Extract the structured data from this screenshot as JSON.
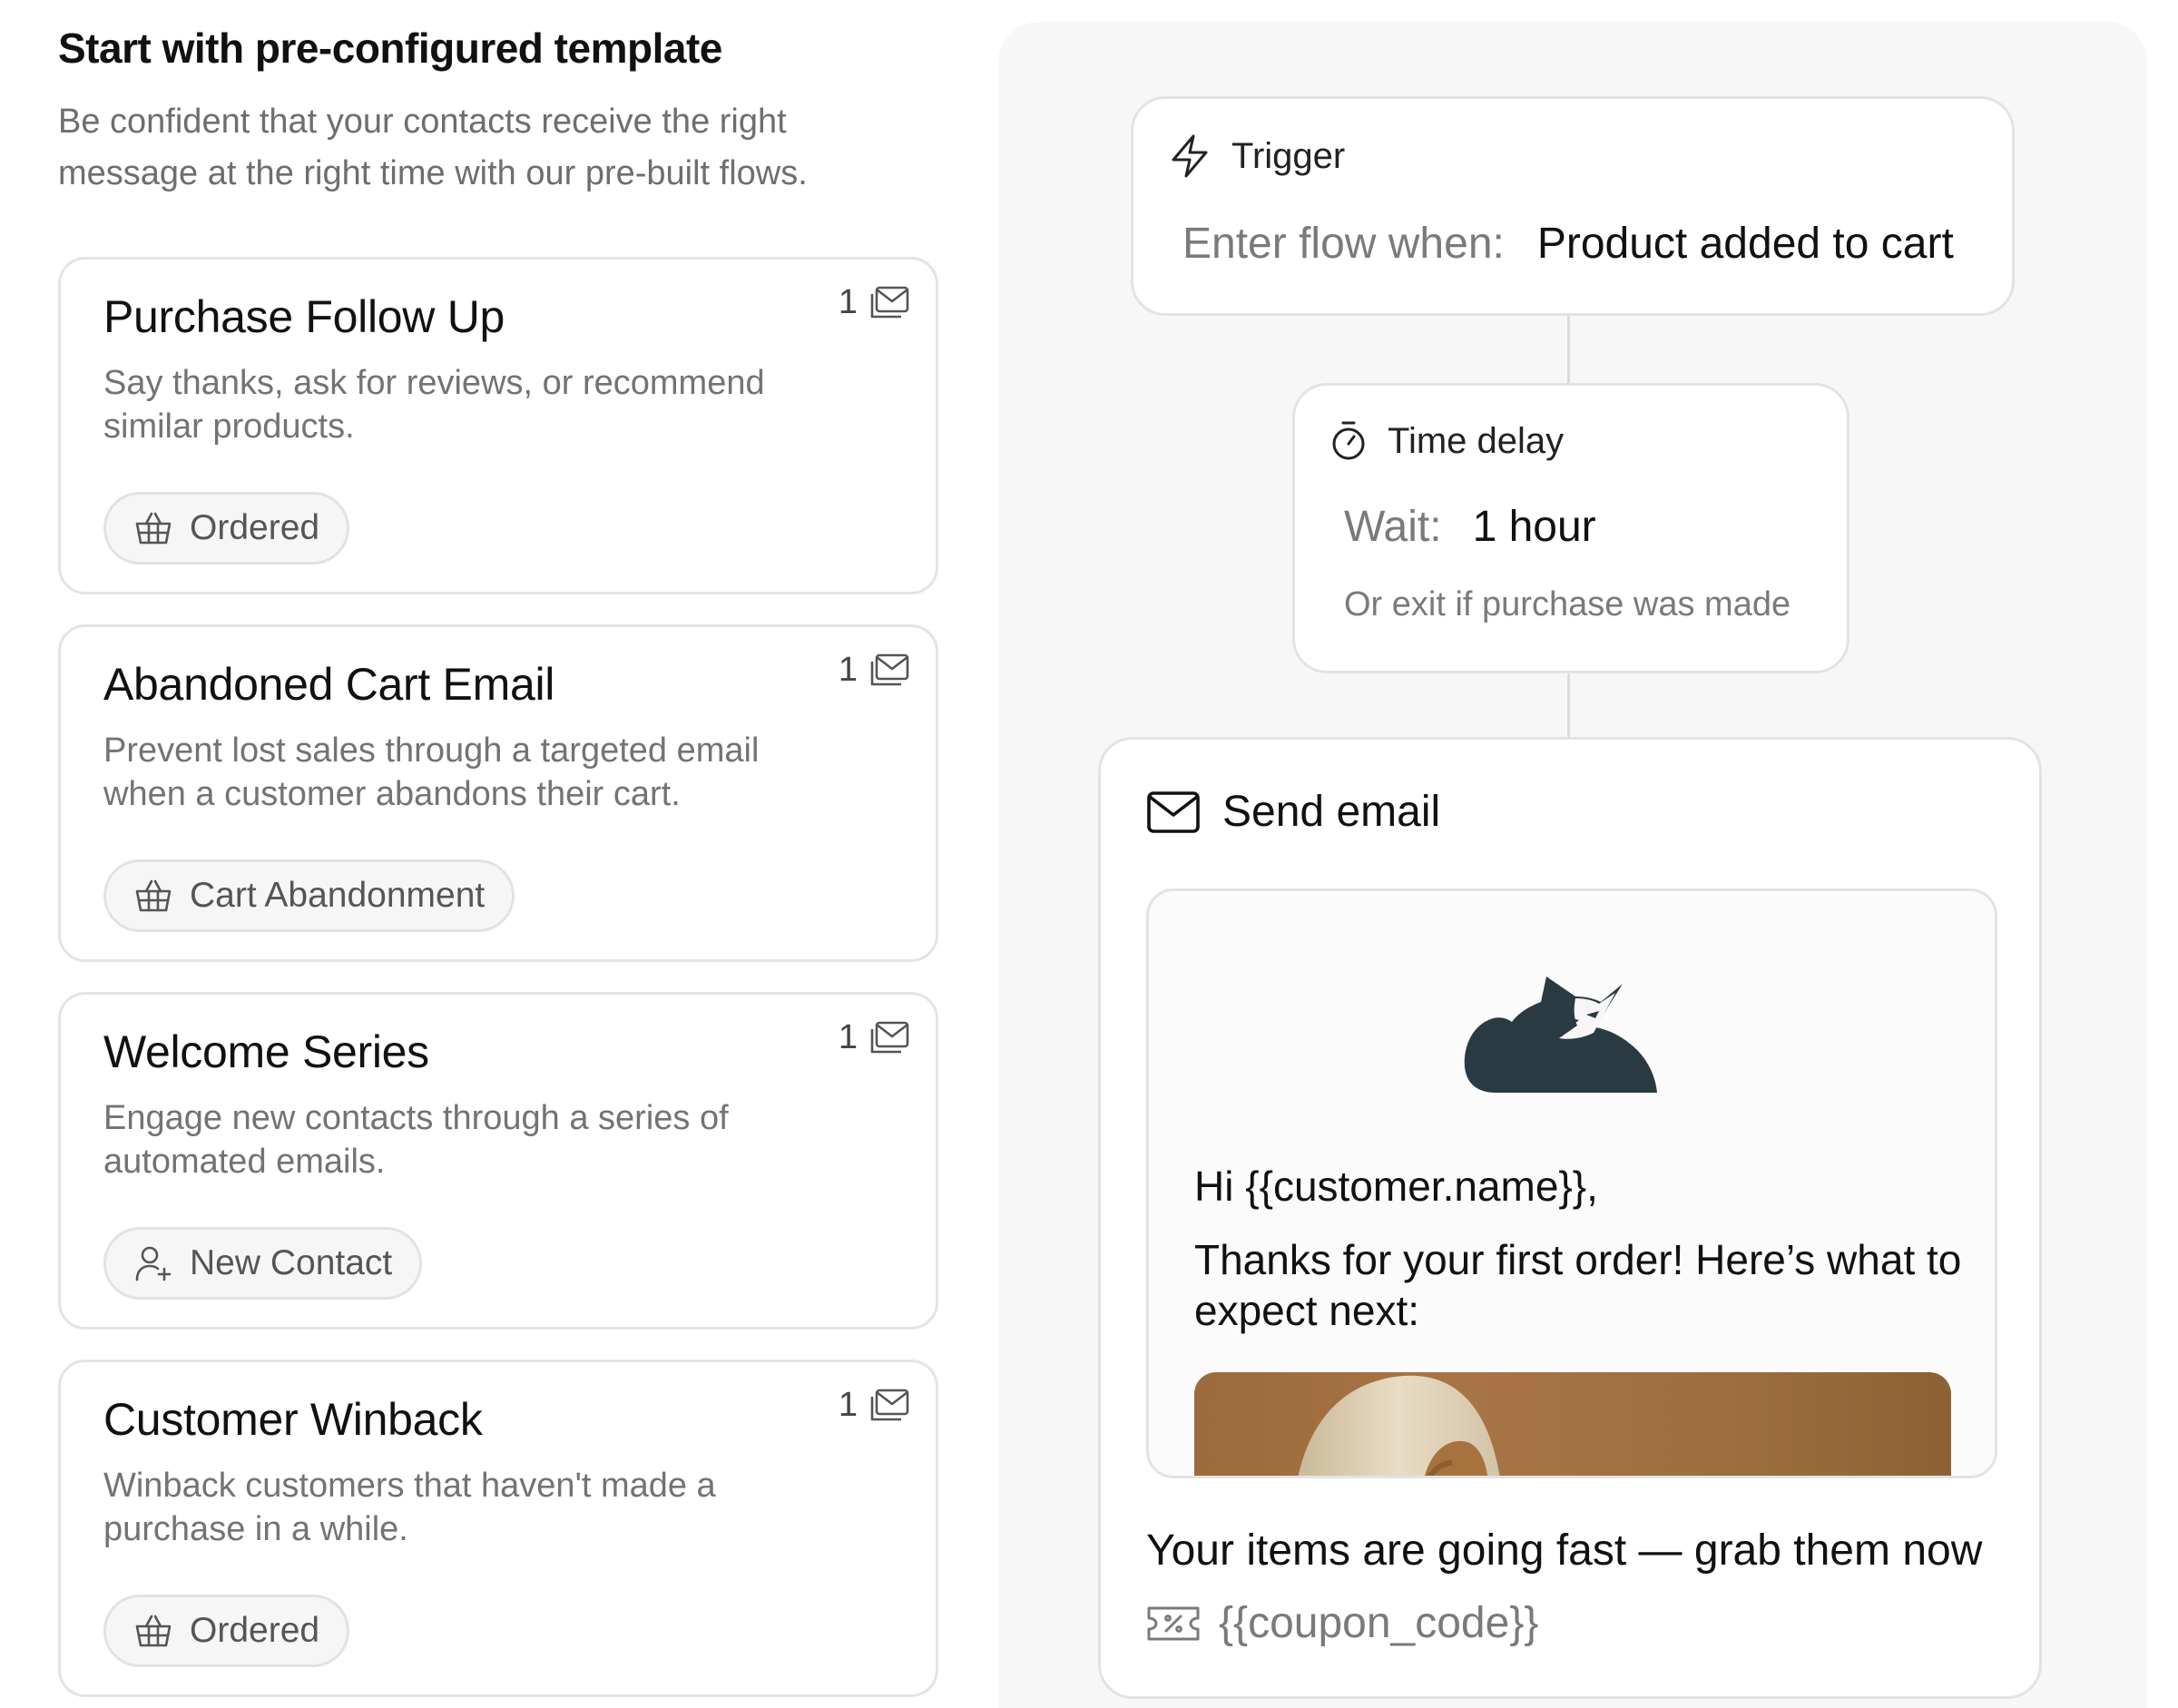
{
  "section": {
    "title": "Start with pre-configured template",
    "intro": "Be confident that your contacts receive the right message at the right time with our pre-built flows."
  },
  "templates": [
    {
      "title": "Purchase Follow Up",
      "description": "Say thanks, ask for reviews, or recommend similar products.",
      "email_count": "1",
      "tag": "Ordered",
      "tag_icon": "basket-icon"
    },
    {
      "title": "Abandoned Cart Email",
      "description": "Prevent lost sales through a targeted email when a customer abandons their cart.",
      "email_count": "1",
      "tag": "Cart Abandonment",
      "tag_icon": "basket-icon"
    },
    {
      "title": "Welcome Series",
      "description": "Engage new contacts through a series of automated emails.",
      "email_count": "1",
      "tag": "New Contact",
      "tag_icon": "user-plus-icon"
    },
    {
      "title": "Customer Winback",
      "description": "Winback customers that haven't made a purchase in a while.",
      "email_count": "1",
      "tag": "Ordered",
      "tag_icon": "basket-icon"
    }
  ],
  "flow": {
    "trigger": {
      "label": "Trigger",
      "key": "Enter flow when:",
      "value": "Product added to cart",
      "icon": "lightning-icon"
    },
    "delay": {
      "label": "Time delay",
      "key": "Wait:",
      "value": "1 hour",
      "note": "Or exit if purchase was made",
      "icon": "stopwatch-icon"
    },
    "email": {
      "label": "Send email",
      "icon": "envelope-icon",
      "preview": {
        "logo": "cat-logo",
        "greeting": "Hi {{customer.name}},",
        "body": "Thanks for your first order! Here’s what to expect next:"
      },
      "cta": "Your items are going fast — grab them now",
      "coupon": "{{coupon_code}}",
      "coupon_icon": "ticket-icon"
    }
  },
  "colors": {
    "panel_bg": "#f7f7f7",
    "border": "#e3e3e3",
    "muted_text": "#737373",
    "logo": "#2a3a42",
    "photo": "#a87445"
  }
}
